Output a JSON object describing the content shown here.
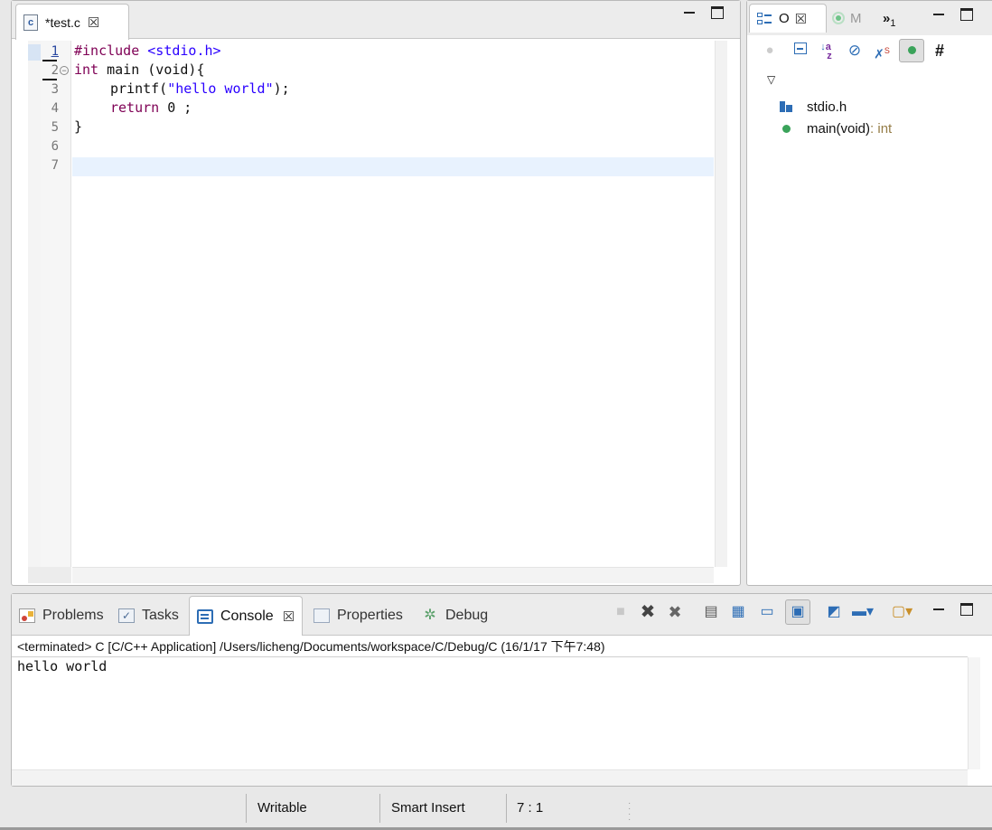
{
  "editor": {
    "tab_label": "*test.c",
    "file_icon_text": "c",
    "close_glyph": "☒",
    "line_numbers": [
      "1",
      "2",
      "3",
      "4",
      "5",
      "6",
      "7"
    ],
    "code": {
      "l1_directive": "#include",
      "l1_header": "<stdio.h>",
      "l2_kw": "int",
      "l2_rest": " main (void){",
      "l3_fn": "printf(",
      "l3_str": "\"hello world\"",
      "l3_end": ");",
      "l4_kw": "return",
      "l4_rest": " 0 ;",
      "l5": "}"
    }
  },
  "outline": {
    "tab_label": "O",
    "tab2_label": "M",
    "overflow_label": "»",
    "overflow_count": "1",
    "toolbar_icons": [
      "hide-fields-icon",
      "collapse-all-icon",
      "sort-az-icon",
      "hide-nonpublic-icon",
      "hide-static-icon",
      "hide-members-icon",
      "hide-macros-icon"
    ],
    "items": [
      {
        "label": "stdio.h",
        "type": ""
      },
      {
        "label": "main(void)",
        "type": " : int"
      }
    ]
  },
  "console": {
    "tabs": [
      {
        "label": "Problems",
        "icon": "problems-icon"
      },
      {
        "label": "Tasks",
        "icon": "tasks-icon"
      },
      {
        "label": "Console",
        "icon": "console-icon"
      },
      {
        "label": "Properties",
        "icon": "properties-icon"
      },
      {
        "label": "Debug",
        "icon": "debug-icon"
      }
    ],
    "status": "<terminated> C [C/C++ Application] /Users/licheng/Documents/workspace/C/Debug/C (16/1/17 下午7:48)",
    "output": "hello world"
  },
  "statusbar": {
    "writable": "Writable",
    "insert_mode": "Smart Insert",
    "position": "7 : 1"
  },
  "colors": {
    "keyword": "#7f0055",
    "string": "#2a00ff",
    "current_line": "#e8f2fe",
    "return_type": "#957d47"
  }
}
